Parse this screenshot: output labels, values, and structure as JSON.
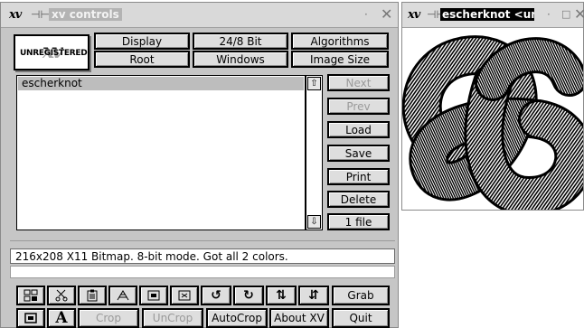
{
  "controls_window": {
    "title": "xv controls",
    "wm_logo": "xv",
    "logo": {
      "text": "UNREGISTERED",
      "mark": "xv"
    },
    "menu_buttons": {
      "display": "Display",
      "bit_depth": "24/8 Bit",
      "algorithms": "Algorithms",
      "root": "Root",
      "windows": "Windows",
      "image_size": "Image Size"
    },
    "file_list": {
      "items": [
        "escherknot"
      ]
    },
    "side_buttons": {
      "next": "Next",
      "prev": "Prev",
      "load": "Load",
      "save": "Save",
      "print": "Print",
      "delete": "Delete",
      "file_count": "1 file"
    },
    "status_text": "216x208 X11 Bitmap.  8-bit mode.  Got all 2 colors.",
    "bottom_buttons": {
      "grab": "Grab",
      "crop": "Crop",
      "uncrop": "UnCrop",
      "autocrop": "AutoCrop",
      "about": "About XV",
      "quit": "Quit",
      "text_icon": "A"
    },
    "icons": [
      "visual-schnauzer-icon",
      "cut-icon",
      "clipboard-icon",
      "paste-icon",
      "normal-size-icon",
      "max-size-icon",
      "rotate-ccw-icon",
      "rotate-cw-icon",
      "flip-horizontal-icon",
      "flip-vertical-icon",
      "pad-icon",
      "annotate-text-icon"
    ]
  },
  "image_window": {
    "title": "escherknot <unreg",
    "image": "escher trefoil knot bitmap"
  }
}
